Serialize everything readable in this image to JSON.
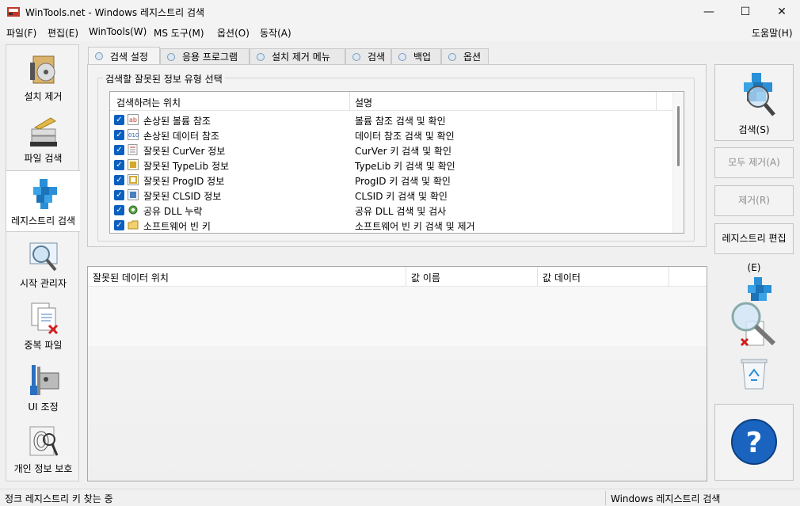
{
  "window": {
    "title": "WinTools.net - Windows 레지스트리 검색",
    "minimize": "—",
    "maximize": "☐",
    "close": "✕"
  },
  "menu": {
    "items": [
      "파일(F)",
      "편집(E)",
      "WinTools(W)",
      "MS 도구(M)",
      "옵션(O)",
      "동작(A)"
    ],
    "help": "도움말(H)"
  },
  "nav": {
    "items": [
      {
        "label": "설치 제거",
        "icon": "uninstall-icon"
      },
      {
        "label": "파일 검색",
        "icon": "file-search-icon"
      },
      {
        "label": "레지스트리 검색",
        "icon": "registry-icon",
        "active": true
      },
      {
        "label": "시작 관리자",
        "icon": "startup-manager-icon"
      },
      {
        "label": "중복 파일",
        "icon": "duplicate-files-icon"
      },
      {
        "label": "UI 조정",
        "icon": "ui-tweak-icon"
      },
      {
        "label": "개인 정보 보호",
        "icon": "privacy-icon"
      }
    ]
  },
  "tabs": [
    {
      "label": "검색 설정",
      "active": true
    },
    {
      "label": "응용 프로그램"
    },
    {
      "label": "설치 제거 메뉴"
    },
    {
      "label": "검색"
    },
    {
      "label": "백업"
    },
    {
      "label": "옵션"
    }
  ],
  "group": {
    "title": "검색할 잘못된 정보 유형 선택"
  },
  "scan_list": {
    "columns": [
      "검색하려는 위치",
      "설명"
    ],
    "rows": [
      {
        "location": "손상된 볼륨 참조",
        "desc": "볼륨 참조 검색 및 확인",
        "checked": true,
        "icon": "volume-ref-icon"
      },
      {
        "location": "손상된 데이터 참조",
        "desc": "데이터 참조 검색 및 확인",
        "checked": true,
        "icon": "data-ref-icon"
      },
      {
        "location": "잘못된 CurVer 정보",
        "desc": "CurVer 키 검색 및 확인",
        "checked": true,
        "icon": "curver-icon"
      },
      {
        "location": "잘못된 TypeLib 정보",
        "desc": "TypeLib 키 검색 및 확인",
        "checked": true,
        "icon": "typelib-icon"
      },
      {
        "location": "잘못된 ProgID 정보",
        "desc": "ProgID 키 검색 및 확인",
        "checked": true,
        "icon": "progid-icon"
      },
      {
        "location": "잘못된 CLSID 정보",
        "desc": "CLSID 키 검색 및 확인",
        "checked": true,
        "icon": "clsid-icon"
      },
      {
        "location": "공유 DLL 누락",
        "desc": "공유 DLL 검색 및 검사",
        "checked": true,
        "icon": "shared-dll-icon"
      },
      {
        "location": "소프트웨어 빈 키",
        "desc": "소프트웨어 빈 키 검색 및 제거",
        "checked": true,
        "icon": "empty-key-icon"
      }
    ]
  },
  "results_list": {
    "columns": [
      "잘못된 데이터 위치",
      "값 이름",
      "값 데이터"
    ]
  },
  "actions": {
    "scan": "검색(S)",
    "remove_all": "모두 제거(A)",
    "remove": "제거(R)",
    "registry_editor": "레지스트리 편집(E)"
  },
  "status": {
    "left": "정크 레지스트리 키 찾는 중",
    "right": "Windows 레지스트리 검색"
  }
}
